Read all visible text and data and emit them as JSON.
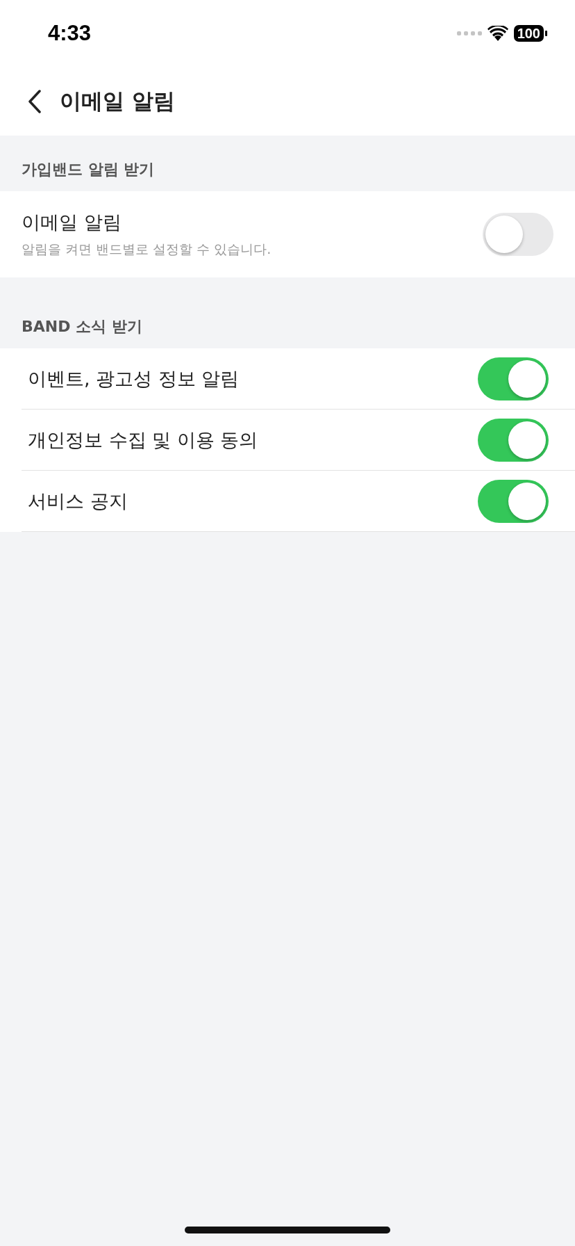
{
  "status_bar": {
    "time": "4:33",
    "battery": "100"
  },
  "nav": {
    "title": "이메일 알림"
  },
  "sections": [
    {
      "header": "가입밴드 알림 받기",
      "rows": [
        {
          "title": "이메일 알림",
          "subtitle": "알림을 켜면 밴드별로 설정할 수 있습니다.",
          "on": false
        }
      ]
    },
    {
      "header": "BAND 소식 받기",
      "rows": [
        {
          "title": "이벤트, 광고성 정보 알림",
          "on": true
        },
        {
          "title": "개인정보 수집 및 이용 동의",
          "on": true
        },
        {
          "title": "서비스 공지",
          "on": true
        }
      ]
    }
  ]
}
